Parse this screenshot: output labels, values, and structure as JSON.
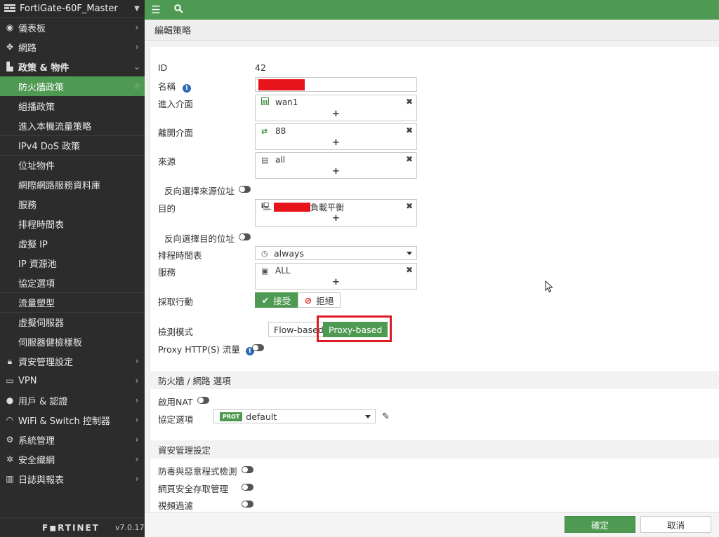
{
  "sidebar": {
    "device_name": "FortiGate-60F_Master",
    "items": [
      {
        "label": "儀表板"
      },
      {
        "label": "網路"
      },
      {
        "label": "政策 & 物件"
      },
      {
        "label": "防火牆政策"
      },
      {
        "label": "組播政策"
      },
      {
        "label": "進入本機流量策略"
      },
      {
        "label": "IPv4 DoS 政策"
      },
      {
        "label": "位址物件"
      },
      {
        "label": "網際網路服務資料庫"
      },
      {
        "label": "服務"
      },
      {
        "label": "排程時間表"
      },
      {
        "label": "虛擬 IP"
      },
      {
        "label": "IP 資源池"
      },
      {
        "label": "協定選項"
      },
      {
        "label": "流量塑型"
      },
      {
        "label": "虛擬伺服器"
      },
      {
        "label": "伺服器健檢樣板"
      },
      {
        "label": "資安管理設定"
      },
      {
        "label": "VPN"
      },
      {
        "label": "用戶 & 認證"
      },
      {
        "label": "WiFi & Switch 控制器"
      },
      {
        "label": "系統管理"
      },
      {
        "label": "安全織網"
      },
      {
        "label": "日誌與報表"
      }
    ],
    "brand": "F◼RTINET",
    "version": "v7.0.17"
  },
  "page_title": "編輯策略",
  "form": {
    "id_label": "ID",
    "id_value": "42",
    "name_label": "名稱",
    "incoming_label": "進入介面",
    "incoming_value": "wan1",
    "outgoing_label": "離開介面",
    "outgoing_value": "88",
    "source_label": "來源",
    "source_value": "all",
    "negate_source_label": "反向選擇來源位址",
    "destination_label": "目的",
    "destination_value_suffix": "負載平衡",
    "negate_dest_label": "反向選擇目的位址",
    "schedule_label": "排程時間表",
    "schedule_value": "always",
    "service_label": "服務",
    "service_value": "ALL",
    "action_label": "採取行動",
    "accept_label": "接受",
    "deny_label": "拒絕",
    "inspection_label": "檢測模式",
    "flow_based": "Flow-based",
    "proxy_based": "Proxy-based",
    "proxy_http_label": "Proxy HTTP(S) 流量",
    "add_symbol": "+",
    "remove_symbol": "✖"
  },
  "fw_section": {
    "title": "防火牆 / 網路 選項",
    "nat_label": "啟用NAT",
    "protocol_label": "協定選項",
    "protocol_badge": "PROT",
    "protocol_value": "default"
  },
  "sec_section": {
    "title": "資安管理設定",
    "av_label": "防毒與惡意程式檢測",
    "web_label": "網頁安全存取管理",
    "video_label": "視頻過濾"
  },
  "buttons": {
    "ok": "確定",
    "cancel": "取消"
  },
  "colors": {
    "accent_green": "#4f9a52",
    "sidebar_bg": "#2c2c2c",
    "highlight_red": "#e8141b",
    "info_blue": "#2a68b3"
  }
}
